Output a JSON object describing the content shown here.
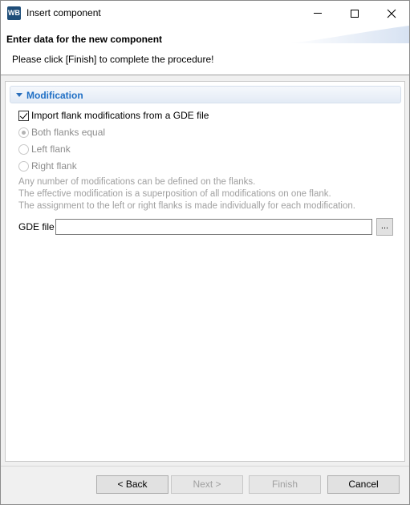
{
  "window": {
    "title": "Insert component",
    "app_icon_text": "WB"
  },
  "header": {
    "title": "Enter data for the new component",
    "message": "Please click [Finish] to complete the procedure!"
  },
  "section": {
    "title": "Modification"
  },
  "options": {
    "import_checkbox_label": "Import flank modifications from a GDE file",
    "import_checked": true,
    "radio_both": "Both flanks equal",
    "radio_left": "Left flank",
    "radio_right": "Right flank",
    "selected_radio": "Both flanks equal"
  },
  "info_lines": [
    "Any number of modifications can be defined on the flanks.",
    "The effective modification is a superposition of all modifications on one flank.",
    "The assignment to the left or right flanks is made individually for each modification."
  ],
  "gde": {
    "label": "GDE file",
    "value": "",
    "browse_label": "..."
  },
  "buttons": {
    "back": "< Back",
    "next": "Next >",
    "finish": "Finish",
    "cancel": "Cancel"
  },
  "colors": {
    "section_title": "#1f6fc5",
    "app_icon_bg": "#1f4e79"
  }
}
